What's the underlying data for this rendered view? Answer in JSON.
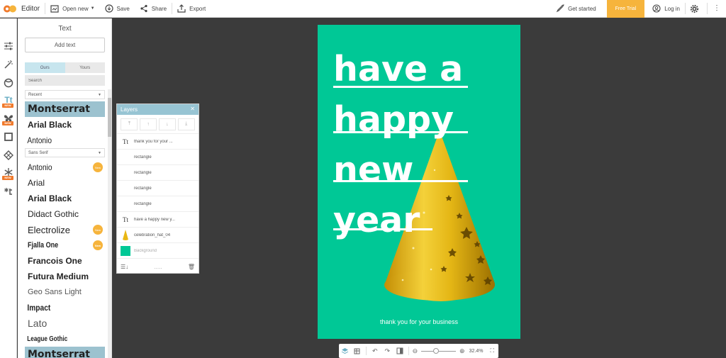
{
  "topbar": {
    "app_title": "Editor",
    "open_new": "Open new",
    "save": "Save",
    "share": "Share",
    "export": "Export",
    "get_started": "Get started",
    "free_trial": "Free Trial",
    "log_in": "Log in"
  },
  "rail": {
    "new_badge": "NEW"
  },
  "text_panel": {
    "title": "Text",
    "add_text": "Add text",
    "tabs": [
      "Ours",
      "Yours"
    ],
    "search_placeholder": "Search",
    "dropdown_recent": "Recent",
    "dropdown_sans_serif": "Sans Serif",
    "new_badge": "New",
    "fonts": [
      "Montserrat",
      "Arial Black",
      "Antonio",
      "Antonio",
      "Arial",
      "Arial Black",
      "Didact Gothic",
      "Electrolize",
      "Fjalla One",
      "Francois One",
      "Futura Medium",
      "Geo Sans Light",
      "Impact",
      "Lato",
      "League Gothic",
      "Montserrat"
    ]
  },
  "layers": {
    "title": "Layers",
    "rows": [
      "thank you for your ...",
      "rectangle",
      "rectangle",
      "rectangle",
      "rectangle",
      "have a happy new y...",
      "celebration_hat_04",
      "Background"
    ],
    "thumb_text": "Tt",
    "dots": "....."
  },
  "canvas": {
    "lines": [
      "have a",
      "happy",
      "new",
      "year"
    ],
    "footer": "thank you for your business",
    "background_color": "#00c896"
  },
  "bottombar": {
    "zoom": "32.4%"
  },
  "colors": {
    "accent": "#97c4d3",
    "free_trial": "#f6b43c",
    "canvas_green": "#00c896"
  }
}
